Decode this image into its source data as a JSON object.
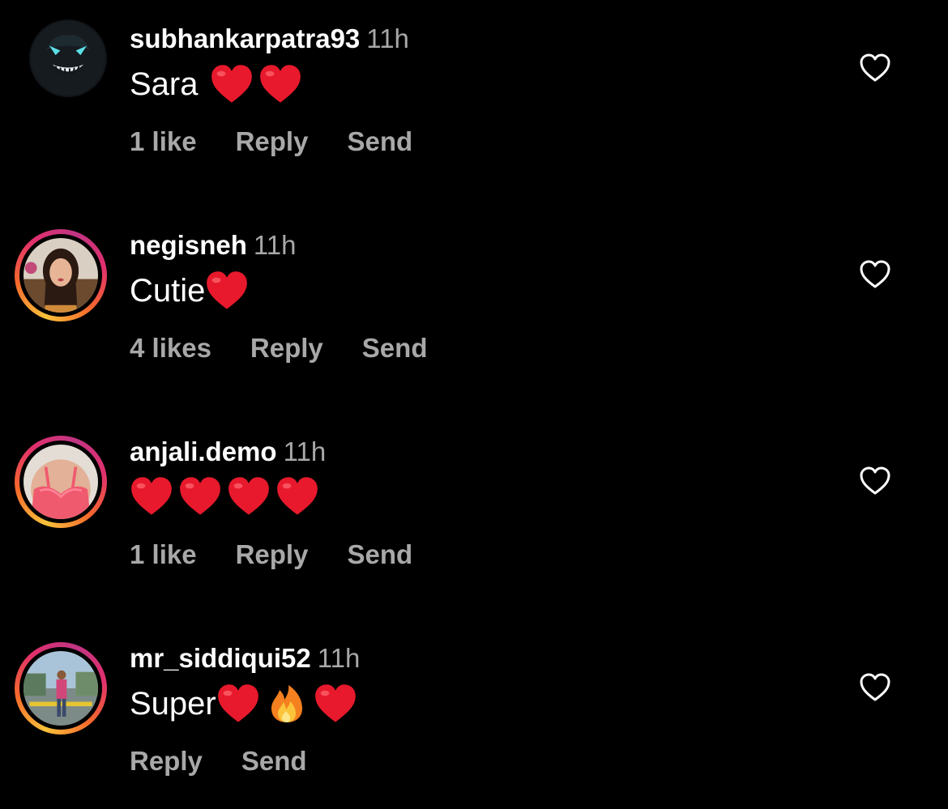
{
  "comments": [
    {
      "username": "subhankarpatra93",
      "time": "11h",
      "text": "Sara",
      "emojis": [
        "red-heart",
        "red-heart"
      ],
      "likes": "1 like",
      "reply": "Reply",
      "send": "Send",
      "has_story_ring": false
    },
    {
      "username": "negisneh",
      "time": "11h",
      "text": "Cutie",
      "emojis": [
        "red-heart"
      ],
      "likes": "4 likes",
      "reply": "Reply",
      "send": "Send",
      "has_story_ring": true
    },
    {
      "username": "anjali.demo",
      "time": "11h",
      "text": "",
      "emojis": [
        "red-heart",
        "red-heart",
        "red-heart",
        "red-heart"
      ],
      "likes": "1 like",
      "reply": "Reply",
      "send": "Send",
      "has_story_ring": true
    },
    {
      "username": "mr_siddiqui52",
      "time": "11h",
      "text": "Super",
      "emojis": [
        "red-heart",
        "fire",
        "red-heart"
      ],
      "likes": "",
      "reply": "Reply",
      "send": "Send",
      "has_story_ring": true
    }
  ],
  "colors": {
    "background": "#000000",
    "primary_text": "#ffffff",
    "secondary_text": "#a8a8a8",
    "heart_red": "#e8192c",
    "story_ring_start": "#f9c13b",
    "story_ring_end": "#c13584"
  },
  "icons": {
    "like_button": "heart-outline-icon"
  }
}
